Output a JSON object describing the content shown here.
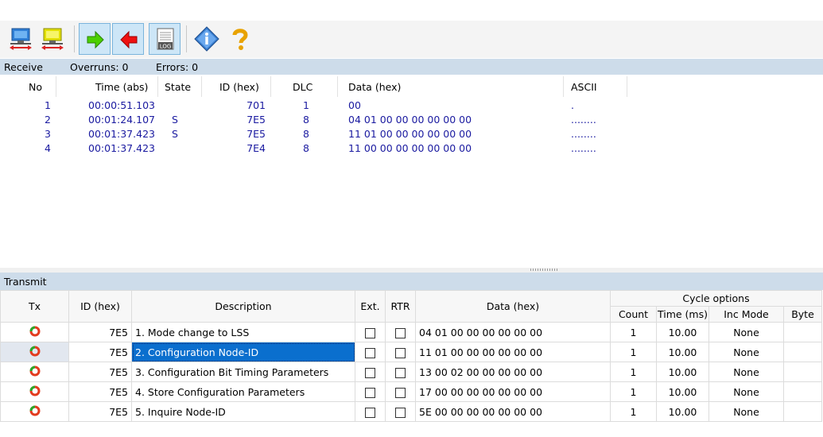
{
  "toolbar": {
    "buttons": [
      "connect-network",
      "disconnect-network",
      "start-send",
      "stop",
      "log",
      "info",
      "help"
    ],
    "log_label": "LOG"
  },
  "receive": {
    "label": "Receive",
    "overruns": "Overruns: 0",
    "errors": "Errors: 0",
    "columns": {
      "no": "No",
      "time": "Time (abs)",
      "state": "State",
      "id": "ID (hex)",
      "dlc": "DLC",
      "data": "Data (hex)",
      "ascii": "ASCII"
    },
    "rows": [
      {
        "no": "1",
        "time": "00:00:51.103",
        "state": "",
        "id": "701",
        "dlc": "1",
        "data": "00",
        "ascii": "."
      },
      {
        "no": "2",
        "time": "00:01:24.107",
        "state": "S",
        "id": "7E5",
        "dlc": "8",
        "data": "04 01 00 00 00 00 00 00",
        "ascii": "........"
      },
      {
        "no": "3",
        "time": "00:01:37.423",
        "state": "S",
        "id": "7E5",
        "dlc": "8",
        "data": "11 01 00 00 00 00 00 00",
        "ascii": "........"
      },
      {
        "no": "4",
        "time": "00:01:37.423",
        "state": "",
        "id": "7E4",
        "dlc": "8",
        "data": "11 00 00 00 00 00 00 00",
        "ascii": "........"
      }
    ],
    "text_color": "#1a1aa0"
  },
  "transmit": {
    "label": "Transmit",
    "columns": {
      "tx": "Tx",
      "id": "ID (hex)",
      "description": "Description",
      "ext": "Ext.",
      "rtr": "RTR",
      "data": "Data (hex)",
      "cycle_options": "Cycle options",
      "count": "Count",
      "time": "Time (ms)",
      "inc_mode": "Inc Mode",
      "byte": "Byte"
    },
    "rows": [
      {
        "id": "7E5",
        "description": "1. Mode change to LSS",
        "data": "04 01 00 00 00 00 00 00",
        "count": "1",
        "time": "10.00",
        "inc_mode": "None",
        "byte": ""
      },
      {
        "id": "7E5",
        "description": "2. Configuration Node-ID",
        "data": "11 01 00 00 00 00 00 00",
        "count": "1",
        "time": "10.00",
        "inc_mode": "None",
        "byte": ""
      },
      {
        "id": "7E5",
        "description": "3. Configuration Bit Timing Parameters",
        "data": "13 00 02 00 00 00 00 00",
        "count": "1",
        "time": "10.00",
        "inc_mode": "None",
        "byte": ""
      },
      {
        "id": "7E5",
        "description": "4. Store Configuration Parameters",
        "data": "17 00 00 00 00 00 00 00",
        "count": "1",
        "time": "10.00",
        "inc_mode": "None",
        "byte": ""
      },
      {
        "id": "7E5",
        "description": "5. Inquire Node-ID",
        "data": "5E 00 00 00 00 00 00 00",
        "count": "1",
        "time": "10.00",
        "inc_mode": "None",
        "byte": ""
      }
    ],
    "selected_row": "2",
    "selection_color": "#0a6fce"
  }
}
